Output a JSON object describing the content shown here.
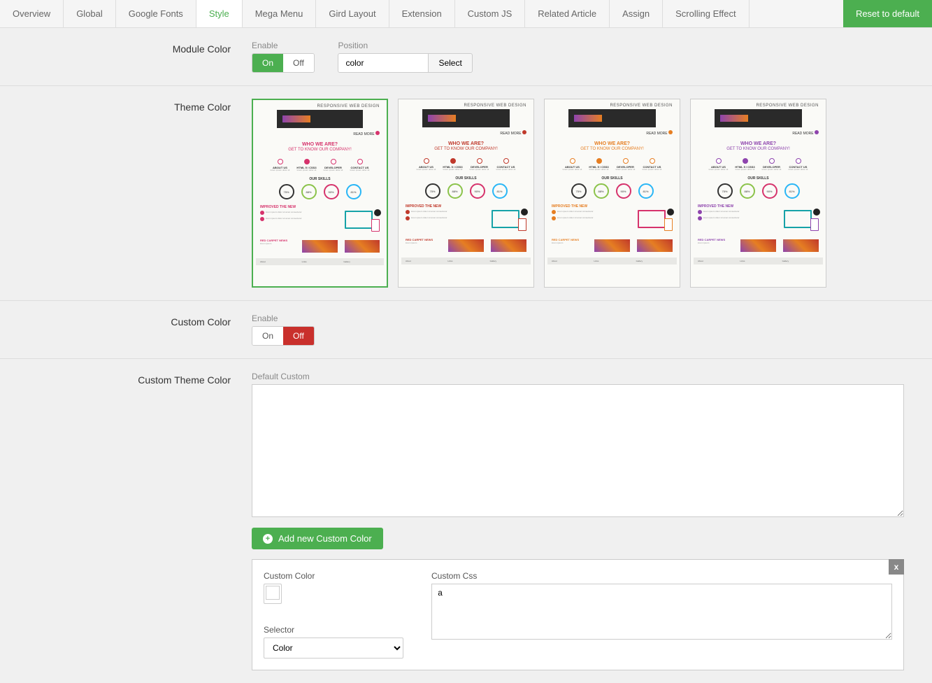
{
  "tabs": {
    "items": [
      "Overview",
      "Global",
      "Google Fonts",
      "Style",
      "Mega Menu",
      "Gird Layout",
      "Extension",
      "Custom JS",
      "Related Article",
      "Assign",
      "Scrolling Effect"
    ],
    "active_index": 3,
    "reset_label": "Reset to default"
  },
  "module_color": {
    "section_label": "Module Color",
    "enable_label": "Enable",
    "on": "On",
    "off": "Off",
    "enabled": true,
    "position_label": "Position",
    "position_value": "color",
    "select_label": "Select"
  },
  "theme_color": {
    "section_label": "Theme Color",
    "selected_index": 0,
    "themes": [
      {
        "accent_class": "accent-pink",
        "accent": "#d6336c",
        "bullets_color": "#d6336c",
        "monitor_color": "#16a2a8"
      },
      {
        "accent_class": "accent-red",
        "accent": "#c0392b",
        "bullets_color": "#c0392b",
        "monitor_color": "#16a2a8"
      },
      {
        "accent_class": "accent-orange",
        "accent": "#e67e22",
        "bullets_color": "#e67e22",
        "monitor_color": "#d6336c"
      },
      {
        "accent_class": "accent-purple",
        "accent": "#8e44ad",
        "bullets_color": "#8e44ad",
        "monitor_color": "#16a2a8"
      }
    ],
    "thumb_text": {
      "tagline": "RESPONSIVE WEB DESIGN",
      "title": "WHO WE ARE?",
      "subtitle": "GET TO KNOW OUR COMPANY!",
      "features": [
        "ABOUT US",
        "HTML 5 / CSS3",
        "DEVELOPER",
        "CONTACT US"
      ],
      "skills_hd": "OUR SKILLS",
      "skills": [
        {
          "pct": "75%",
          "color": "#333"
        },
        {
          "pct": "88%",
          "color": "#8bc34a"
        },
        {
          "pct": "90%",
          "color": "#d6336c"
        },
        {
          "pct": "81%",
          "color": "#29b6f6"
        }
      ],
      "improved": "IMPROVED THE NEW",
      "news_hd": "RED CARPET NEWS"
    }
  },
  "custom_color": {
    "section_label": "Custom Color",
    "enable_label": "Enable",
    "on": "On",
    "off": "Off",
    "enabled": false
  },
  "custom_theme_color": {
    "section_label": "Custom Theme Color",
    "default_label": "Default Custom",
    "default_value": "",
    "add_btn_label": "Add new Custom Color",
    "box": {
      "custom_color_label": "Custom Color",
      "selector_label": "Selector",
      "selector_value": "Color",
      "custom_css_label": "Custom Css",
      "custom_css_value": "a",
      "close": "x"
    }
  }
}
